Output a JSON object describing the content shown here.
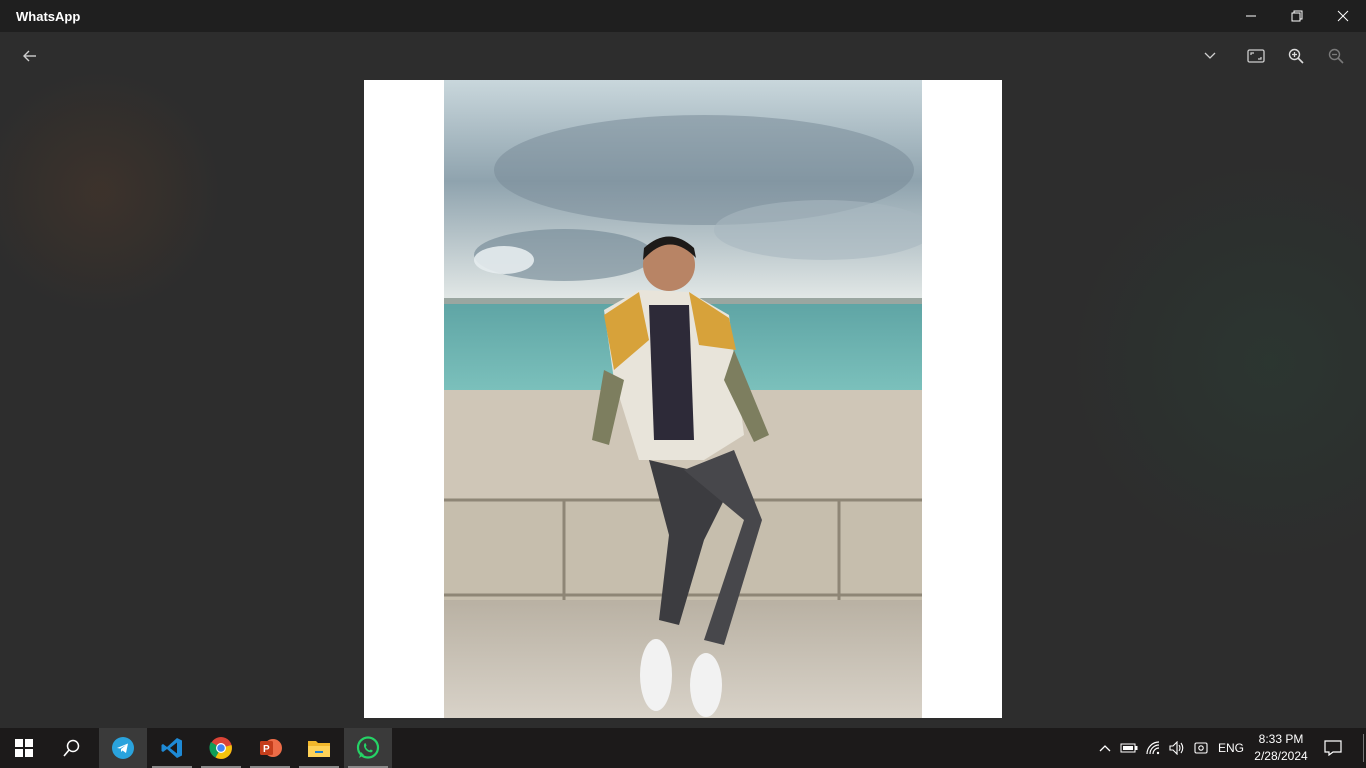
{
  "window": {
    "title": "WhatsApp"
  },
  "viewer": {
    "toolbar": {
      "back_icon": "arrow-left-icon",
      "more_icon": "chevron-down-icon",
      "fit_icon": "fit-to-screen-icon",
      "zoom_in_icon": "zoom-in-icon",
      "zoom_out_icon": "zoom-out-icon"
    }
  },
  "taskbar": {
    "apps": [
      "telegram",
      "visual-studio-code",
      "google-chrome",
      "powerpoint",
      "file-explorer",
      "whatsapp"
    ],
    "active_app": "whatsapp",
    "tray": {
      "language": "ENG",
      "time": "8:33 PM",
      "date": "2/28/2024"
    }
  },
  "colors": {
    "titlebar": "#1f1f1f",
    "viewer_bg": "#2d2d2d",
    "taskbar": "#1c1a1a",
    "whatsapp_green": "#25d366"
  }
}
